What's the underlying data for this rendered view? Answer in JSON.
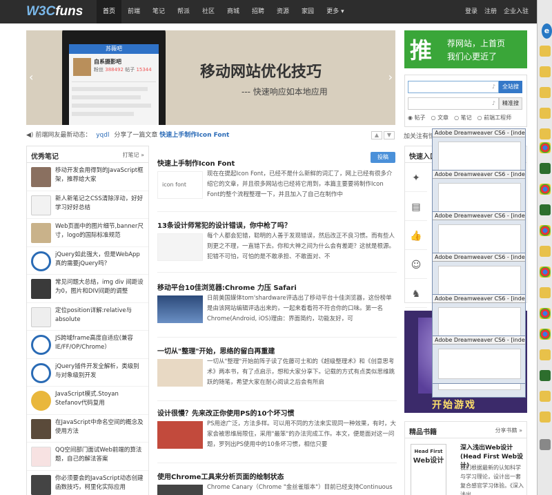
{
  "header": {
    "logo_main": "W3C",
    "logo_sub": "funs",
    "nav": [
      "首页",
      "前端",
      "笔记",
      "帮派",
      "社区",
      "商城",
      "招聘",
      "资源",
      "家园",
      "更多 ▾"
    ],
    "right": [
      "登录",
      "注册",
      "企业入驻"
    ]
  },
  "slider": {
    "title": "移动网站优化技巧",
    "subtitle": "--- 快速响应如本地应用",
    "phone_app": "苏薇吧",
    "phone_user": "自系摄影吧",
    "phone_fans_label": "粉丝",
    "phone_fans": "388492",
    "phone_posts_label": "帖子",
    "phone_posts": "15344"
  },
  "ad": {
    "big": "推",
    "line1": "荐网站，上首页",
    "line2": "我们心更近了"
  },
  "search": {
    "btn1": "全站搜",
    "btn2": "精准搜",
    "radios": [
      "帖子",
      "文章",
      "笔记",
      "前端工程师"
    ]
  },
  "dynamic": {
    "label": "前端网友最新动态：",
    "user": "yqdl",
    "action": "分享了一篇文章",
    "link": "快速上手制作Icon Font"
  },
  "recommend": "加关注有惊喜",
  "notes": {
    "title": "优秀笔记",
    "more": "打笔记 »",
    "items": [
      "移动开发会用得到的JavaScript框架，推荐给大家",
      "新人新笔记之CSS清除浮动，好好学习好好总结",
      "Web页面中的图片细节,banner尺寸，logo的国际标准规范",
      "jQuery如此强大，但是WebApp真的需要jQuery吗？",
      "常见问题大总结，img div 间距设为0，图片和DIV间距的调整",
      "定位position详解:relative与absolute",
      "JS跨域frame高度自适应(兼容IE/FF/OP/Chrome）",
      "jQuery插件开发全解析，类级别与对象级别开发",
      "JavaScript模式.Stoyan Stefanov代码复用",
      "在JavaScript中命名空间的概念及使用方法",
      "QQ空间部门面试Web前端的算法题，自己的解法答案",
      "你必须要会的JavaScript动态创建函数技巧，柯里化实际应用"
    ]
  },
  "articles": {
    "submit": "投稿",
    "items": [
      {
        "title": "快速上手制作Icon Font",
        "desc": "现在在提起Icon Font，已经不是什么新鲜的词汇了，网上已经有很多介绍它的文章，并且很多网站也已经将它用到，本篇主要要将制作Icon Font的整个流程整理一下，并且加入了自己在制作中"
      },
      {
        "title": "13条设计师常犯的设计错误，你中枪了吗？",
        "desc": "每个人都会犯错，聪明的人善于发现错误，然后改正不良习惯。而有些人则更之不理，一直错下去。你和大神之间为什么会有差距？这就是根源。犯错不可怕，可怕的是不敢承担、不敢面对、不"
      },
      {
        "title": "移动平台10佳浏览器:Chrome 力压 Safari",
        "desc": "日前美国媒体tom'shardware评选出了移动平台十佳浏览器，这份榜单是由该网站编辑评选出来的，一起来看看符不符合你的口味。第一名Chrome(Android, iOS)理由：界面简约，功能友好，可"
      },
      {
        "title": "一切从\"整理\"开始，思络的留白再重建",
        "desc": "一切从\"整理\"开始前阵子读了佐藤可士和的《超级整理术》和《创意思考术》两本书，有了点启示，想和大家分享下。记载的方式有点类似思维跳跃的随笔，希望大家在耐心阅读之后会有所启"
      },
      {
        "title": "设计很慢？先来改正你使用PS的10个坏习惯",
        "desc": "PS用途广泛，方法多样。可以用不同的方法来实现同一种效果，有时，大家会被思维局限住，采用\"最笨\"的办法完成工作。本文，便是面对这一问题，罗列出PS使用中的10条坏习惯，相信只要"
      },
      {
        "title": "使用Chrome工具来分析页面的绘制状态",
        "desc": "Chrome Canary（Chrome \"金丝雀版本\"）目前已经支持Continuous"
      }
    ]
  },
  "quick": {
    "title": "快速入口"
  },
  "dw_windows": "Adobe Dreamweaver CS6 - [index.html]",
  "game_text": "开始游戏",
  "books": {
    "title": "精品书籍",
    "more": "分享书籍 »",
    "book_title": "深入浅出Web设计(Head First Web设计)",
    "book_desc": "我们根据最新的认知科学与学习理论，设计出一套复合感官学习体验。《深入浅出",
    "cover_line1": "Head First",
    "cover_line2": "Web设计"
  }
}
